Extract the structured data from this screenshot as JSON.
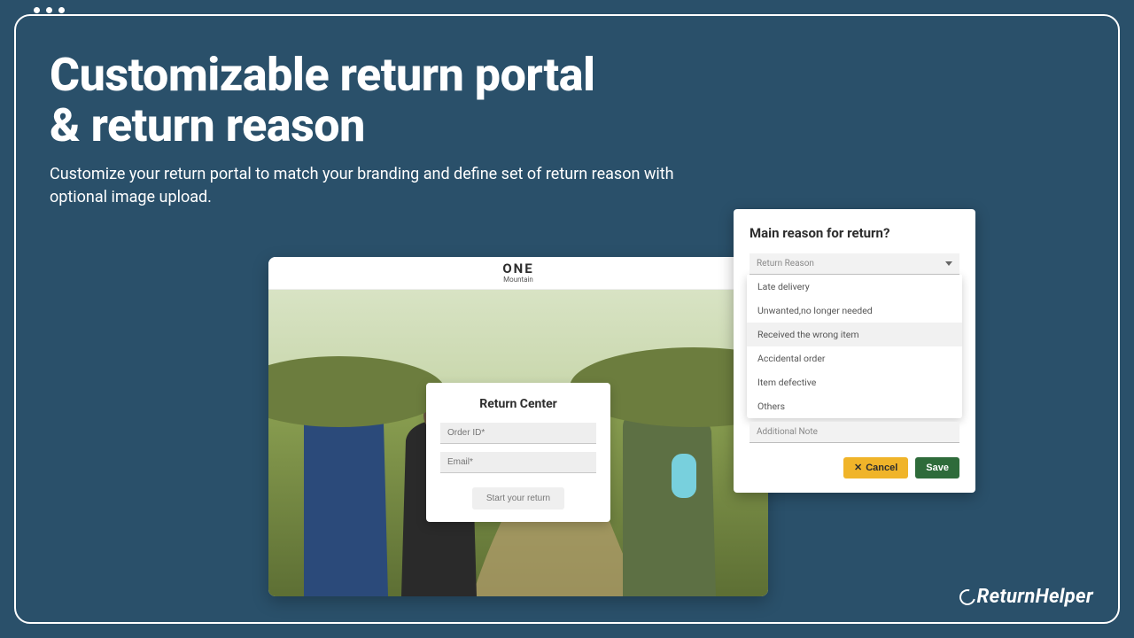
{
  "heading": {
    "title_line1": "Customizable return portal",
    "title_line2": "& return reason",
    "subtitle": "Customize your return portal to match your branding and define set of return reason with optional image upload."
  },
  "portal": {
    "brand_name": "ONE",
    "brand_sub": "Mountain",
    "card_title": "Return Center",
    "order_placeholder": "Order ID*",
    "email_placeholder": "Email*",
    "start_label": "Start your return"
  },
  "reason": {
    "title": "Main reason for return?",
    "select_placeholder": "Return Reason",
    "options": {
      "0": "Late delivery",
      "1": "Unwanted,no longer needed",
      "2": "Received the wrong item",
      "3": "Accidental order",
      "4": "Item defective",
      "5": "Others"
    },
    "selected_index": 2,
    "note_placeholder": "Additional Note",
    "cancel_label": "Cancel",
    "save_label": "Save"
  },
  "footer": {
    "logo_text": "ReturnHelper"
  }
}
